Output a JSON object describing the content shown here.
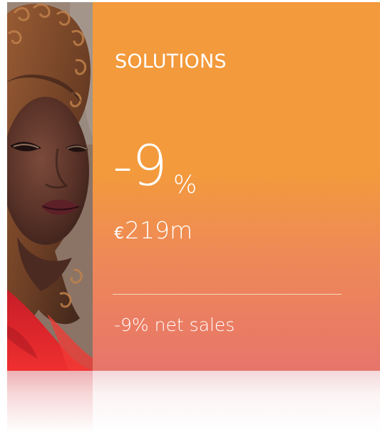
{
  "solutions_card": {
    "title": "SOLUTIONS",
    "change_value": "-9",
    "change_unit": "%",
    "currency_symbol": "€",
    "amount": "219m",
    "net_sales_text": "-9% net sales",
    "photo_label": "portrait of woman with curly hair",
    "colors": {
      "accent_top": "#f39a3c",
      "accent_bottom": "#e7756b",
      "text": "#ffffff",
      "photo_red": "#d72a2a"
    }
  }
}
